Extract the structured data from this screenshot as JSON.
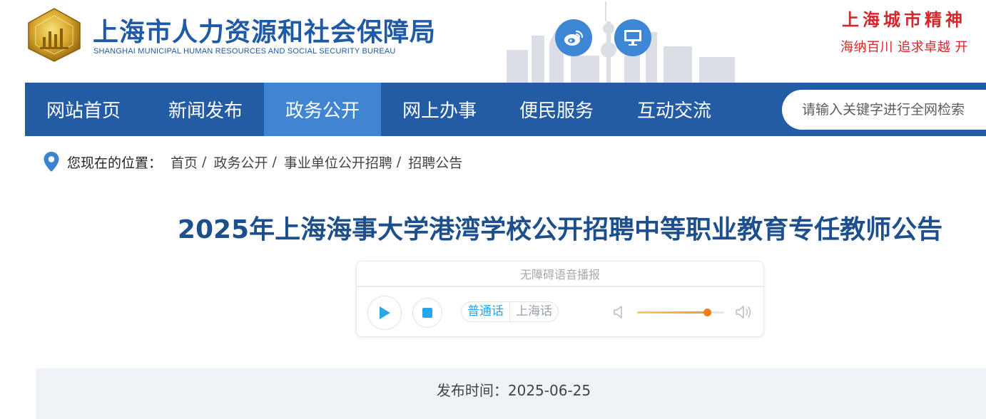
{
  "header": {
    "site_title": "上海市人力资源和社会保障局",
    "site_subtitle": "SHANGHAI MUNICIPAL HUMAN RESOURCES AND SOCIAL SECURITY BUREAU",
    "logo_icon": "bureau-emblem",
    "weibo_icon": "weibo-icon",
    "pc_icon": "monitor-icon",
    "spirit_title": "上海城市精神",
    "spirit_sub": "海纳百川  追求卓越  开"
  },
  "nav": {
    "items": [
      {
        "label": "网站首页",
        "active": false
      },
      {
        "label": "新闻发布",
        "active": false
      },
      {
        "label": "政务公开",
        "active": true
      },
      {
        "label": "网上办事",
        "active": false
      },
      {
        "label": "便民服务",
        "active": false
      },
      {
        "label": "互动交流",
        "active": false
      }
    ],
    "search_placeholder": "请输入关键字进行全网检索"
  },
  "breadcrumb": {
    "label": "您现在的位置：",
    "items": [
      "首页",
      "政务公开",
      "事业单位公开招聘",
      "招聘公告"
    ],
    "separator": "/"
  },
  "article": {
    "title": "2025年上海海事大学港湾学校公开招聘中等职业教育专任教师公告"
  },
  "audio": {
    "header": "无障碍语音播报",
    "languages": [
      "普通话",
      "上海话"
    ],
    "active_language": "普通话",
    "volume": 0.8,
    "colors": {
      "accent": "#2aa6e6",
      "knob": "#f57c16"
    }
  },
  "publish": {
    "text": "发布时间：2025-06-25"
  },
  "colors": {
    "nav_bg": "#235ba5",
    "nav_active": "#3f85d2",
    "title": "#1d4f8c",
    "spirit": "#d5262b"
  }
}
